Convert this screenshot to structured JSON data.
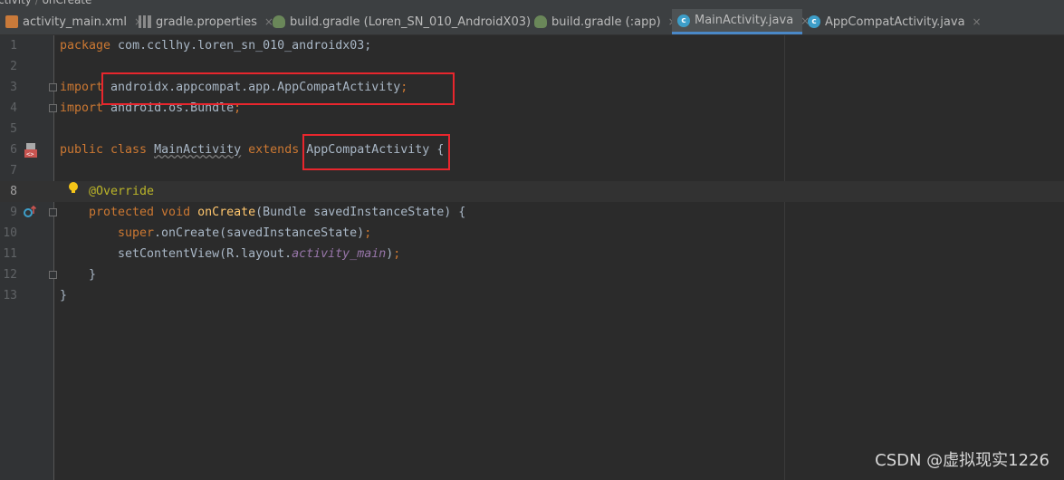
{
  "breadcrumb": {
    "class_name": "ctivity",
    "method_name": "onCreate"
  },
  "tabs": [
    {
      "label": "activity_main.xml",
      "icon": "xml-file-icon",
      "active": false
    },
    {
      "label": "gradle.properties",
      "icon": "properties-file-icon",
      "active": false
    },
    {
      "label": "build.gradle (Loren_SN_010_AndroidX03)",
      "icon": "gradle-file-icon",
      "active": false
    },
    {
      "label": "build.gradle (:app)",
      "icon": "gradle-file-icon",
      "active": false
    },
    {
      "label": "MainActivity.java",
      "icon": "java-class-icon",
      "active": true
    },
    {
      "label": "AppCompatActivity.java",
      "icon": "java-class-icon",
      "active": false
    }
  ],
  "close_glyph": "×",
  "editor": {
    "current_line": 8,
    "line_numbers": [
      "1",
      "2",
      "3",
      "4",
      "5",
      "6",
      "7",
      "8",
      "9",
      "10",
      "11",
      "12",
      "13"
    ],
    "l1": {
      "kw": "package",
      "rest": " com.ccllhy.loren_sn_010_androidx03;"
    },
    "l3": {
      "kw": "import",
      "pre": " androidx.appcompat.app.AppCompatActivity",
      "semi": ";"
    },
    "l4": {
      "kw": "import",
      "rest": " android.os.Bundle",
      "semi": ";"
    },
    "l6": {
      "kw1": "public class ",
      "cls": "MainActivity",
      "kw2": " extends ",
      "parent": "AppCompatActivity {"
    },
    "l8": {
      "ann": "@Override"
    },
    "l9": {
      "kw": "protected void ",
      "fn": "onCreate",
      "rest": "(Bundle savedInstanceState) {"
    },
    "l10": {
      "kw": "super",
      "rest": ".onCreate(savedInstanceState)",
      "semi": ";"
    },
    "l11": {
      "pre": "setContentView(R.layout.",
      "field": "activity_main",
      "post": ")",
      "semi": ";"
    },
    "l12": {
      "text": "}"
    },
    "l13": {
      "text": "}"
    }
  },
  "watermark": "CSDN @虚拟现实1226",
  "colors": {
    "keyword": "#cc7832",
    "annotation": "#bbb529",
    "method": "#ffc66d",
    "field": "#9876aa",
    "highlight_box": "#e8262d"
  }
}
